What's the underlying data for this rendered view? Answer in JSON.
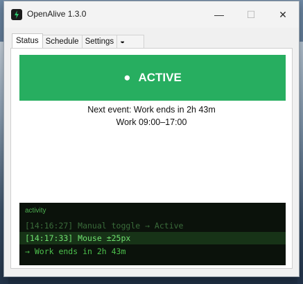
{
  "window": {
    "title": "OpenAlive 1.3.0",
    "controls": {
      "minimize": "—",
      "maximize": "☐",
      "close": "✕"
    }
  },
  "tabs": [
    {
      "label": "Status",
      "active": true
    },
    {
      "label": "Schedule",
      "active": false
    },
    {
      "label": "Settings",
      "active": false
    },
    {
      "label": "◒",
      "active": false
    }
  ],
  "status": {
    "dot": "●",
    "label": "ACTIVE",
    "color": "#27ae60",
    "next_event": "Next event: Work ends in 2h 43m",
    "schedule": "Work 09:00–17:00"
  },
  "activity": {
    "label": "activity",
    "lines": [
      "[14:16:27] Manual toggle → Active",
      "[14:17:33] Mouse ±25px",
      "→ Work ends in 2h 43m"
    ]
  }
}
